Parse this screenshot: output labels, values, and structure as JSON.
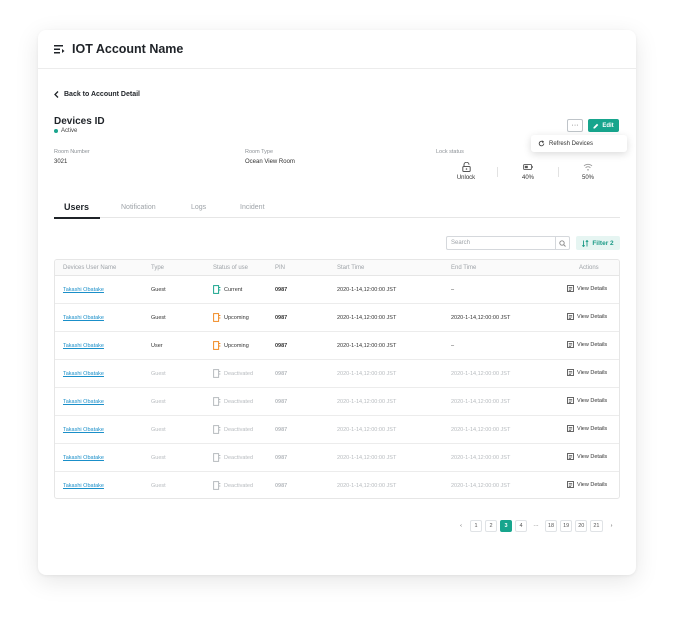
{
  "header": {
    "title": "IOT Account Name"
  },
  "back_link": "Back to Account Detail",
  "device": {
    "title": "Devices ID",
    "status": "Active",
    "status_color": "#1aa58e"
  },
  "actions": {
    "more": "···",
    "edit": "Edit",
    "accent": "#17a58d",
    "dropdown_item": "Refresh Devices"
  },
  "info": {
    "room_number_label": "Room Number",
    "room_number": "3021",
    "room_type_label": "Room Type",
    "room_type": "Ocean View Room",
    "lock_status_label": "Lock status",
    "lock": "Unlock",
    "battery": "40%",
    "signal": "50%"
  },
  "tabs": [
    {
      "label": "Users"
    },
    {
      "label": "Notification"
    },
    {
      "label": "Logs"
    },
    {
      "label": "Incident"
    }
  ],
  "search": {
    "placeholder": "Search"
  },
  "filter": {
    "label": "Filter",
    "count": "2"
  },
  "table": {
    "headers": [
      "Devices User Name",
      "Type",
      "Status of use",
      "PIN",
      "Start Time",
      "End Time",
      "Actions"
    ],
    "rows": [
      {
        "name": "Takashi Obatake",
        "type": "Guest",
        "status": "Current",
        "pin": "0987",
        "start": "2020-1-14,12:00:00 JST",
        "end": "–",
        "action": "View Details"
      },
      {
        "name": "Takashi Obatake",
        "type": "Guest",
        "status": "Upcoming",
        "pin": "0987",
        "start": "2020-1-14,12:00:00 JST",
        "end": "2020-1-14,12:00:00 JST",
        "action": "View Details"
      },
      {
        "name": "Takashi Obatake",
        "type": "User",
        "status": "Upcoming",
        "pin": "0987",
        "start": "2020-1-14,12:00:00 JST",
        "end": "–",
        "action": "View Details"
      },
      {
        "name": "Takashi Obatake",
        "type": "Guest",
        "status": "Deactivated",
        "pin": "0987",
        "start": "2020-1-14,12:00:00 JST",
        "end": "2020-1-14,12:00:00 JST",
        "action": "View Details"
      },
      {
        "name": "Takashi Obatake",
        "type": "Guest",
        "status": "Deactivated",
        "pin": "0987",
        "start": "2020-1-14,12:00:00 JST",
        "end": "2020-1-14,12:00:00 JST",
        "action": "View Details"
      },
      {
        "name": "Takashi Obatake",
        "type": "Guest",
        "status": "Deactivated",
        "pin": "0987",
        "start": "2020-1-14,12:00:00 JST",
        "end": "2020-1-14,12:00:00 JST",
        "action": "View Details"
      },
      {
        "name": "Takashi Obatake",
        "type": "Guest",
        "status": "Deactivated",
        "pin": "0987",
        "start": "2020-1-14,12:00:00 JST",
        "end": "2020-1-14,12:00:00 JST",
        "action": "View Details"
      },
      {
        "name": "Takashi Obatake",
        "type": "Guest",
        "status": "Deactivated",
        "pin": "0987",
        "start": "2020-1-14,12:00:00 JST",
        "end": "2020-1-14,12:00:00 JST",
        "action": "View Details"
      }
    ]
  },
  "status_colors": {
    "Current": "#1aa58e",
    "Upcoming": "#f08a24",
    "Deactivated": "#b7bbbf"
  },
  "pagination": {
    "prev": "‹",
    "next": "›",
    "pages": [
      "1",
      "2",
      "3",
      "4",
      "···",
      "18",
      "19",
      "20",
      "21"
    ],
    "current": "3"
  }
}
